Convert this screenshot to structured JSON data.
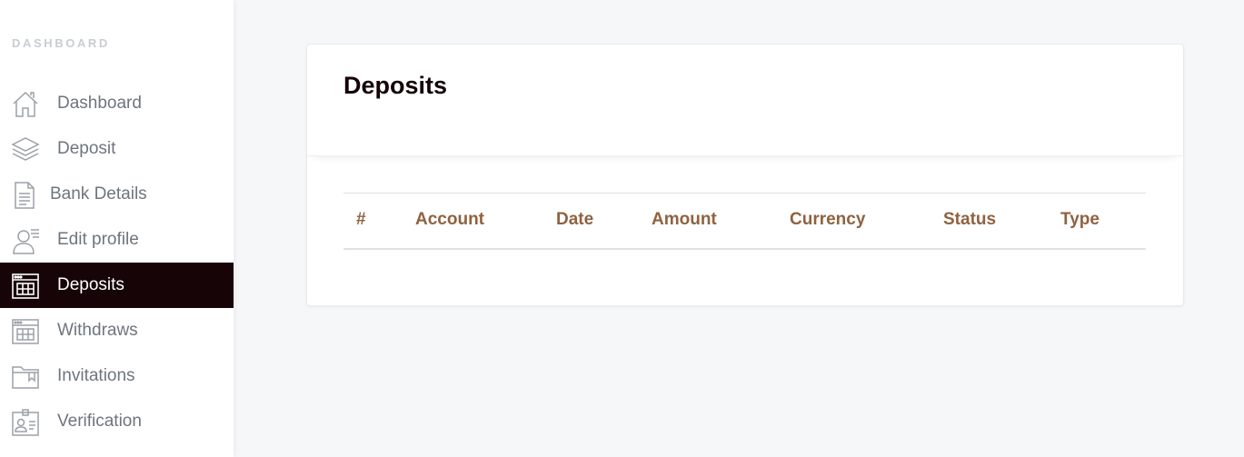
{
  "sidebar": {
    "heading": "DASHBOARD",
    "items": [
      {
        "label": "Dashboard",
        "icon": "home-icon"
      },
      {
        "label": "Deposit",
        "icon": "layers-icon"
      },
      {
        "label": "Bank Details",
        "icon": "document-icon"
      },
      {
        "label": "Edit profile",
        "icon": "user-edit-icon"
      },
      {
        "label": "Deposits",
        "icon": "table-window-icon",
        "active": true
      },
      {
        "label": "Withdraws",
        "icon": "table-window-icon"
      },
      {
        "label": "Invitations",
        "icon": "folder-icon"
      },
      {
        "label": "Verification",
        "icon": "id-card-icon"
      }
    ]
  },
  "main": {
    "title": "Deposits",
    "table": {
      "columns": [
        "#",
        "Account",
        "Date",
        "Amount",
        "Currency",
        "Status",
        "Type"
      ],
      "rows": []
    }
  },
  "colors": {
    "active_bg": "#170406",
    "header_text": "#8f6240",
    "sidebar_text": "#6e757e",
    "page_bg": "#f6f7f9"
  }
}
